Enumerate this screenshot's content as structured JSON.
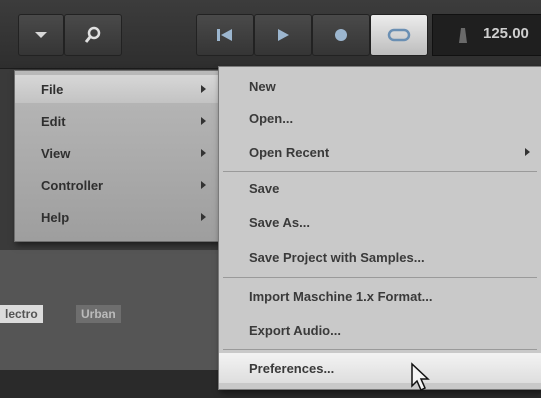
{
  "toolbar": {
    "tempo": "125.00"
  },
  "menu": {
    "items": [
      {
        "label": "File",
        "has_submenu": true,
        "active": true
      },
      {
        "label": "Edit",
        "has_submenu": true
      },
      {
        "label": "View",
        "has_submenu": true
      },
      {
        "label": "Controller",
        "has_submenu": true
      },
      {
        "label": "Help",
        "has_submenu": true
      }
    ]
  },
  "file_menu": {
    "items": [
      {
        "label": "New"
      },
      {
        "label": "Open..."
      },
      {
        "label": "Open Recent",
        "has_submenu": true
      },
      {
        "label": "Save"
      },
      {
        "label": "Save As..."
      },
      {
        "label": "Save Project with Samples..."
      },
      {
        "label": "Import Maschine 1.x Format..."
      },
      {
        "label": "Export Audio..."
      },
      {
        "label": "Preferences...",
        "hover": true
      }
    ]
  },
  "tags": {
    "electro": "lectro",
    "urban": "Urban"
  },
  "colors": {
    "menu_bg": "#b0b0b0",
    "submenu_bg": "#c9c9c9",
    "hover_bg": "#eeeeee",
    "toolbar_bg": "#333333"
  }
}
